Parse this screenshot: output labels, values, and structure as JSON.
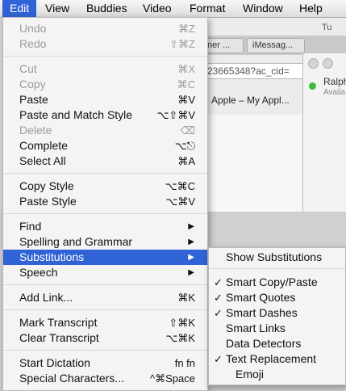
{
  "menubar": {
    "items": [
      "Edit",
      "View",
      "Buddies",
      "Video",
      "Format",
      "Window",
      "Help"
    ],
    "active": "Edit"
  },
  "background": {
    "browser_title": "Tu",
    "tabs": [
      "ner ...",
      "iMessag..."
    ],
    "url": "23665348?ac_cid=",
    "bookmark": "Apple – My Appl...",
    "contact_name": "Ralph",
    "contact_status": "Availa"
  },
  "menu": {
    "undo": {
      "label": "Undo",
      "shortcut": "⌘Z"
    },
    "redo": {
      "label": "Redo",
      "shortcut": "⇧⌘Z"
    },
    "cut": {
      "label": "Cut",
      "shortcut": "⌘X"
    },
    "copy": {
      "label": "Copy",
      "shortcut": "⌘C"
    },
    "paste": {
      "label": "Paste",
      "shortcut": "⌘V"
    },
    "paste_match": {
      "label": "Paste and Match Style",
      "shortcut": "⌥⇧⌘V"
    },
    "delete": {
      "label": "Delete",
      "shortcut": "⌫"
    },
    "complete": {
      "label": "Complete",
      "shortcut": "⌥⎋"
    },
    "select_all": {
      "label": "Select All",
      "shortcut": "⌘A"
    },
    "copy_style": {
      "label": "Copy Style",
      "shortcut": "⌥⌘C"
    },
    "paste_style": {
      "label": "Paste Style",
      "shortcut": "⌥⌘V"
    },
    "find": {
      "label": "Find"
    },
    "spelling": {
      "label": "Spelling and Grammar"
    },
    "substitutions": {
      "label": "Substitutions"
    },
    "speech": {
      "label": "Speech"
    },
    "add_link": {
      "label": "Add Link...",
      "shortcut": "⌘K"
    },
    "mark_transcript": {
      "label": "Mark Transcript",
      "shortcut": "⇧⌘K"
    },
    "clear_transcript": {
      "label": "Clear Transcript",
      "shortcut": "⌥⌘K"
    },
    "start_dictation": {
      "label": "Start Dictation",
      "shortcut": "fn fn"
    },
    "special_chars": {
      "label": "Special Characters...",
      "shortcut": "^⌘Space"
    },
    "submenu_arrow": "▶"
  },
  "submenu": {
    "show_substitutions": "Show Substitutions",
    "check": "✓",
    "smart_copy_paste": "Smart Copy/Paste",
    "smart_quotes": "Smart Quotes",
    "smart_dashes": "Smart Dashes",
    "smart_links": "Smart Links",
    "data_detectors": "Data Detectors",
    "text_replacement": "Text Replacement",
    "emoji": "Emoji"
  },
  "colors": {
    "highlight": "#2f63d6",
    "disabled": "#9b9b9b"
  }
}
